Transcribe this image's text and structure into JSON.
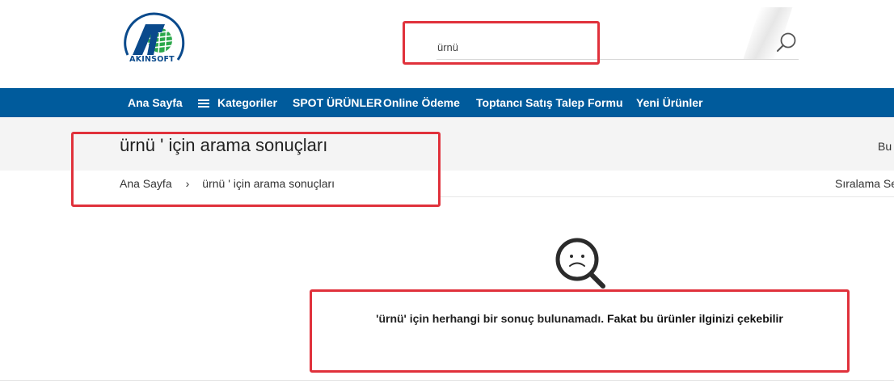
{
  "brand": {
    "name": "AKINSOFT",
    "colors": {
      "primary": "#0a4a8c",
      "accent": "#2aa84a",
      "nav": "#005b9c",
      "highlight": "#e0313b"
    }
  },
  "search": {
    "value": "ürnü",
    "icon": "search-icon"
  },
  "nav": {
    "items": [
      {
        "label": "Ana Sayfa"
      },
      {
        "label": "Kategoriler",
        "icon": "hamburger-menu-icon"
      },
      {
        "label": "SPOT ÜRÜNLER"
      },
      {
        "label": "Online Ödeme"
      },
      {
        "label": "Toptancı Satış Talep Formu"
      },
      {
        "label": "Yeni Ürünler"
      }
    ]
  },
  "page": {
    "title": "ürnü ' için arama sonuçları",
    "right_text": "Bu",
    "sort_label": "Sıralama Se"
  },
  "breadcrumb": {
    "home": "Ana Sayfa",
    "separator": "›",
    "current": "ürnü ' için arama sonuçları"
  },
  "no_result": {
    "icon": "sad-magnifier-icon",
    "message_part1": "'ürnü' için herhangi bir sonuç bulunamadı.",
    "message_part2": "Fakat bu ürünler ilginizi çekebilir"
  }
}
